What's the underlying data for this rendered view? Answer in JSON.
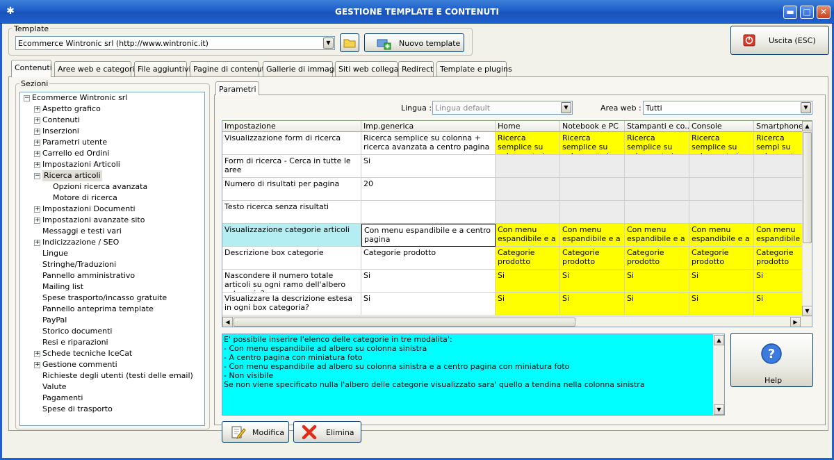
{
  "window": {
    "title": "GESTIONE TEMPLATE E CONTENUTI",
    "minimize": "▬",
    "maximize": "□",
    "close": "✕"
  },
  "template": {
    "group_label": "Template",
    "selected": "Ecommerce Wintronic srl (http://www.wintronic.it)",
    "new_button": "Nuovo template"
  },
  "exit_button": "Uscita (ESC)",
  "tabs": [
    "Contenuti",
    "Aree web e categorie",
    "File aggiuntivi",
    "Pagine di contenuti",
    "Gallerie di immagini",
    "Siti web collegati",
    "Redirect",
    "Template e plugins"
  ],
  "sections": {
    "group_label": "Sezioni",
    "root": "Ecommerce Wintronic srl",
    "items": [
      {
        "label": "Aspetto grafico",
        "expander": "+"
      },
      {
        "label": "Contenuti",
        "expander": "+"
      },
      {
        "label": "Inserzioni",
        "expander": "+"
      },
      {
        "label": "Parametri utente",
        "expander": "+"
      },
      {
        "label": "Carrello ed Ordini",
        "expander": "+"
      },
      {
        "label": "Impostazioni Articoli",
        "expander": "+"
      },
      {
        "label": "Ricerca articoli",
        "expander": "−"
      },
      {
        "label": "Opzioni ricerca avanzata",
        "expander": ""
      },
      {
        "label": "Motore di ricerca",
        "expander": ""
      },
      {
        "label": "Impostazioni Documenti",
        "expander": "+"
      },
      {
        "label": "Impostazioni avanzate sito",
        "expander": "+"
      },
      {
        "label": "Messaggi e testi vari",
        "expander": ""
      },
      {
        "label": "Indicizzazione / SEO",
        "expander": "+"
      },
      {
        "label": "Lingue",
        "expander": ""
      },
      {
        "label": "Stringhe/Traduzioni",
        "expander": ""
      },
      {
        "label": "Pannello amministrativo",
        "expander": ""
      },
      {
        "label": "Mailing list",
        "expander": ""
      },
      {
        "label": "Spese trasporto/incasso gratuite",
        "expander": ""
      },
      {
        "label": "Pannello anteprima template",
        "expander": ""
      },
      {
        "label": "PayPal",
        "expander": ""
      },
      {
        "label": "Storico documenti",
        "expander": ""
      },
      {
        "label": "Resi e riparazioni",
        "expander": ""
      },
      {
        "label": "Schede tecniche IceCat",
        "expander": "+"
      },
      {
        "label": "Gestione commenti",
        "expander": "+"
      },
      {
        "label": "Richieste degli utenti (testi delle email)",
        "expander": ""
      },
      {
        "label": "Valute",
        "expander": ""
      },
      {
        "label": "Pagamenti",
        "expander": ""
      },
      {
        "label": "Spese di trasporto",
        "expander": ""
      }
    ]
  },
  "params_tab": "Parametri",
  "lingua": {
    "label": "Lingua :",
    "value": "Lingua default"
  },
  "area_web": {
    "label": "Area web :",
    "value": "Tutti"
  },
  "grid": {
    "headers": [
      "Impostazione",
      "Imp.generica",
      "Home",
      "Notebook e PC",
      "Stampanti e co...",
      "Console",
      "Smartphone e"
    ],
    "rows": [
      {
        "name": "Visualizzazione form di ricerca",
        "generic": "Ricerca semplice su colonna + ricerca avanzata a centro pagina",
        "area": "Ricerca semplice su colonna + ri...",
        "last": "Ricerca sempl su colonna +"
      },
      {
        "name": "Form di ricerca - Cerca in tutte le aree",
        "generic": "Si",
        "area": "",
        "last": ""
      },
      {
        "name": "Numero di risultati per pagina",
        "generic": "20",
        "area": "",
        "last": ""
      },
      {
        "name": "Testo ricerca senza risultati",
        "generic": "",
        "area": "",
        "last": ""
      },
      {
        "name": "Visualizzazione categorie articoli",
        "generic": "Con menu espandibile e a centro pagina",
        "area": "Con menu espandibile e a ...",
        "last": "Con menu espandibile e a"
      },
      {
        "name": "Descrizione box categorie",
        "generic": "Categorie prodotto",
        "area": "Categorie prodotto",
        "last": "Categorie prodotto"
      },
      {
        "name": "Nascondere il numero totale articoli su ogni ramo dell'albero categorie?",
        "generic": "Si",
        "area": "Si",
        "last": "Si"
      },
      {
        "name": "Visualizzare la descrizione estesa in ogni box categoria?",
        "generic": "Si",
        "area": "Si",
        "last": "Si"
      }
    ]
  },
  "description": [
    "E' possibile inserire l'elenco delle categorie in tre modalita':",
    "- Con menu espandibile ad albero su colonna sinistra",
    "- A centro pagina con miniatura foto",
    "- Con menu espandibile ad albero su colonna sinistra e a centro pagina con miniatura foto",
    "- Non visibile",
    "Se non viene specificato nulla l'albero delle categorie visualizzato sara' quello a tendina nella colonna sinistra"
  ],
  "help_button": "Help",
  "modifica_button": "Modifica",
  "elimina_button": "Elimina",
  "colors": {
    "title_bar": "#1f5fd0",
    "yellow": "#ffff00",
    "cyan": "#00ffff",
    "selected": "#b4edf2"
  }
}
